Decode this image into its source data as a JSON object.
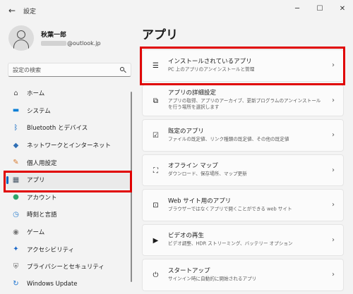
{
  "window": {
    "title": "設定",
    "back_glyph": "←",
    "minimize_glyph": "─",
    "maximize_glyph": "☐",
    "close_glyph": "✕"
  },
  "user": {
    "name": "秋葉一郎",
    "email_domain": "@outlook.jp"
  },
  "search": {
    "placeholder": "設定の検索"
  },
  "nav": {
    "items": [
      {
        "label": "ホーム",
        "icon": "home-icon",
        "glyph": "⌂",
        "color": "#555555"
      },
      {
        "label": "システム",
        "icon": "system-icon",
        "glyph": "▬",
        "color": "#0a7fd6"
      },
      {
        "label": "Bluetooth とデバイス",
        "icon": "bluetooth-icon",
        "glyph": "ᛒ",
        "color": "#0a66c2"
      },
      {
        "label": "ネットワークとインターネット",
        "icon": "wifi-icon",
        "glyph": "◆",
        "color": "#2f6fb5"
      },
      {
        "label": "個人用設定",
        "icon": "brush-icon",
        "glyph": "✎",
        "color": "#d87b2d"
      },
      {
        "label": "アプリ",
        "icon": "apps-icon",
        "glyph": "▦",
        "color": "#4a5a6a"
      },
      {
        "label": "アカウント",
        "icon": "account-icon",
        "glyph": "●",
        "color": "#2ea56a"
      },
      {
        "label": "時刻と言語",
        "icon": "time-language-icon",
        "glyph": "◷",
        "color": "#2d7fcf"
      },
      {
        "label": "ゲーム",
        "icon": "game-icon",
        "glyph": "◉",
        "color": "#777777"
      },
      {
        "label": "アクセシビリティ",
        "icon": "accessibility-icon",
        "glyph": "✦",
        "color": "#1a67c9"
      },
      {
        "label": "プライバシーとセキュリティ",
        "icon": "shield-icon",
        "glyph": "⛨",
        "color": "#6b6b6b"
      },
      {
        "label": "Windows Update",
        "icon": "windows-update-icon",
        "glyph": "↻",
        "color": "#1a73d0"
      }
    ]
  },
  "main": {
    "title": "アプリ",
    "cards": [
      {
        "title": "インストールされているアプリ",
        "desc": "PC 上のアプリのアンインストールと管理",
        "icon": "installed-apps-icon",
        "glyph": "☰"
      },
      {
        "title": "アプリの詳細設定",
        "desc": "アプリの取得、アプリのアーカイブ、更新プログラムのアンインストールを行う場所を選択します",
        "icon": "advanced-apps-icon",
        "glyph": "⧉"
      },
      {
        "title": "既定のアプリ",
        "desc": "ファイルの既定値、リンク種類の既定値、その他の既定値",
        "icon": "default-apps-icon",
        "glyph": "☑"
      },
      {
        "title": "オフライン マップ",
        "desc": "ダウンロード、保存場所、マップ更新",
        "icon": "offline-maps-icon",
        "glyph": "⛶"
      },
      {
        "title": "Web サイト用のアプリ",
        "desc": "ブラウザーではなくアプリで開くことができる web サイト",
        "icon": "website-apps-icon",
        "glyph": "⊡"
      },
      {
        "title": "ビデオの再生",
        "desc": "ビデオ調整、HDR ストリーミング、バッテリー オプション",
        "icon": "video-playback-icon",
        "glyph": "▶"
      },
      {
        "title": "スタートアップ",
        "desc": "サインイン時に自動的に開始されるアプリ",
        "icon": "startup-icon",
        "glyph": "⏻"
      }
    ],
    "chevron": "›"
  },
  "highlight_color": "#e00000"
}
